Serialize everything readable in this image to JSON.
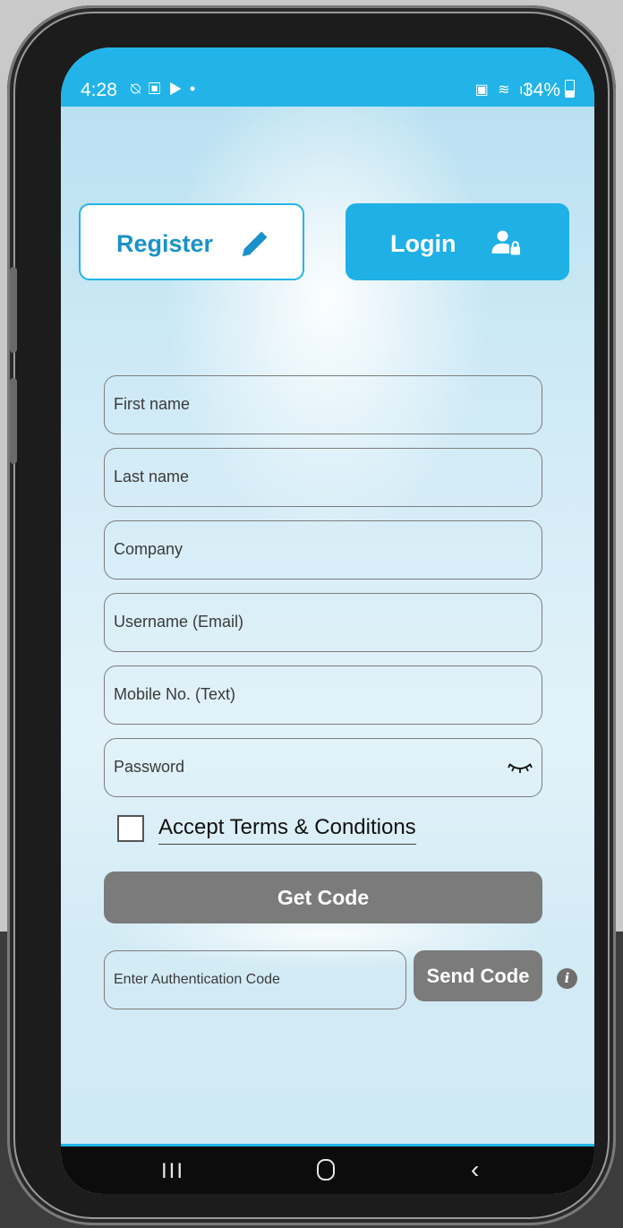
{
  "status_bar": {
    "time": "4:28",
    "battery_percent": "34%",
    "left_icons": "⍉ ▣ ▶ •",
    "right_icons": "▣ ≋ ıl"
  },
  "tabs": {
    "register_label": "Register",
    "login_label": "Login"
  },
  "form": {
    "first_name_placeholder": "First name",
    "last_name_placeholder": "Last name",
    "company_placeholder": "Company",
    "username_placeholder": "Username (Email)",
    "mobile_placeholder": "Mobile No. (Text)",
    "password_placeholder": "Password",
    "terms_label": "Accept Terms & Conditions",
    "terms_checked": false,
    "get_code_label": "Get Code",
    "auth_code_placeholder": "Enter Authentication Code",
    "send_code_label": "Send Code"
  },
  "nav": {
    "recents": "III",
    "back": "‹"
  },
  "colors": {
    "accent": "#22b4e8",
    "button_gray": "#7b7b7b"
  },
  "icons": {
    "register": "pencil-icon",
    "login": "user-lock-icon",
    "password": "eye-closed-icon",
    "info": "info-icon"
  }
}
